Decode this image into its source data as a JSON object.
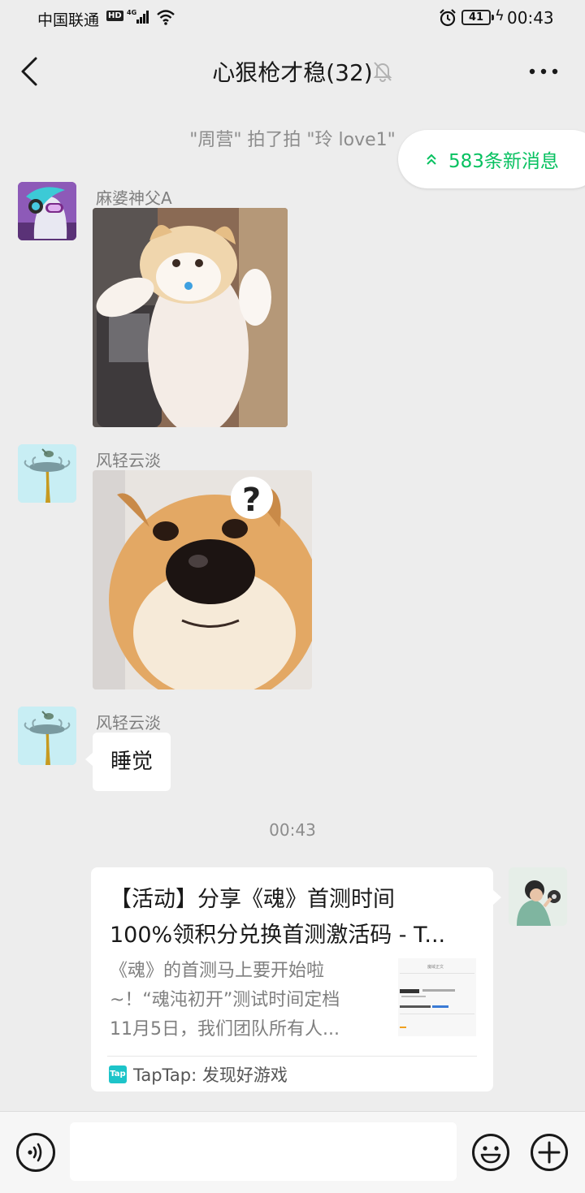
{
  "status_bar": {
    "carrier": "中国联通",
    "hd": "HD",
    "network": "4G",
    "battery": "41",
    "time": "00:43"
  },
  "header": {
    "title": "心狠枪才稳(32)"
  },
  "system_message": "\"周营\" 拍了拍 \"玲 love1\"",
  "new_messages": {
    "label": "583条新消息"
  },
  "messages": [
    {
      "sender": "麻婆神父A",
      "type": "image",
      "content": "cat sticker"
    },
    {
      "sender": "风轻云淡",
      "type": "image",
      "content": "shiba question sticker"
    },
    {
      "sender": "风轻云淡",
      "type": "text",
      "text": "睡觉"
    }
  ],
  "time_divider": "00:43",
  "link_card": {
    "title_line1": "【活动】分享《魂》首测时间",
    "title_line2": "100%领积分兑换首测激活码 - T...",
    "desc_line1": "《魂》的首测马上要开始啦",
    "desc_line2": "~！“魂沌初开”测试时间定档",
    "desc_line3": "11月5日，我们团队所有人...",
    "source": "TapTap: 发现好游戏",
    "thumb_heading": "魔域正文"
  },
  "input": {
    "placeholder": ""
  },
  "colors": {
    "accent": "#07c160",
    "background": "#ededed"
  }
}
